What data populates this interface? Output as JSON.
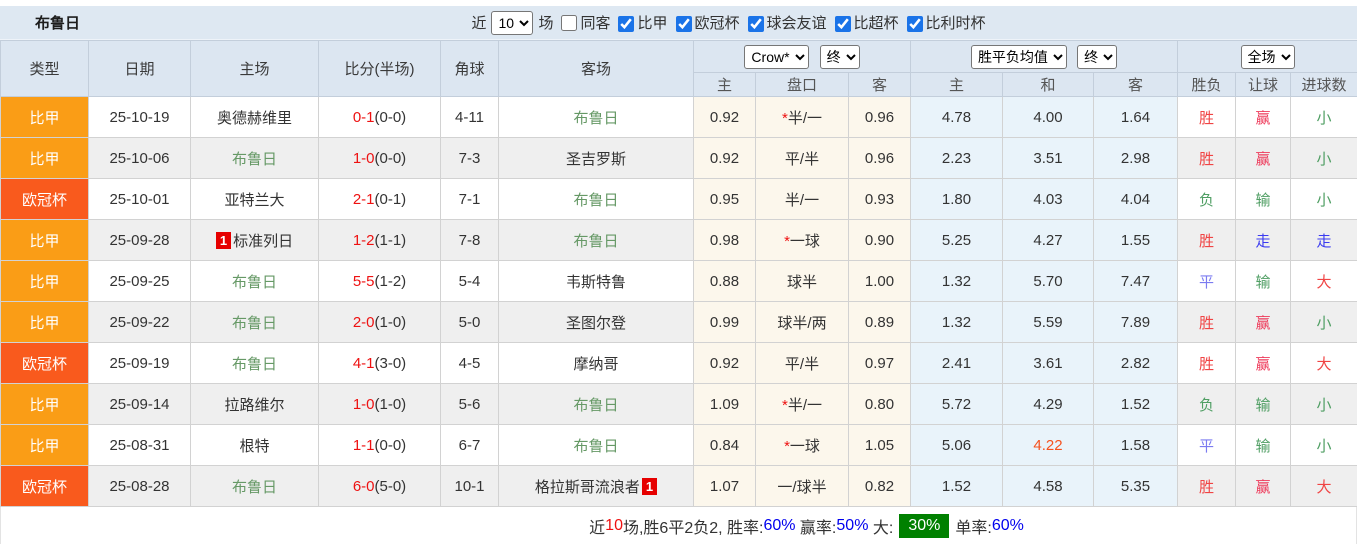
{
  "filter_bar": {
    "title": "布鲁日",
    "recent_label": "近",
    "matches_select": "10",
    "matches_label": "场",
    "same_opponent": {
      "label": "同客",
      "checked": false
    },
    "leagues": [
      {
        "label": "比甲",
        "checked": true
      },
      {
        "label": "欧冠杯",
        "checked": true
      },
      {
        "label": "球会友谊",
        "checked": true
      },
      {
        "label": "比超杯",
        "checked": true
      },
      {
        "label": "比利时杯",
        "checked": true
      }
    ]
  },
  "colors": {
    "league_bijia": "#fa9d16",
    "league_ouguan": "#f95a1d",
    "team_green": "#669966",
    "plain_dark": "#333333",
    "red": "#f04444",
    "crimson": "#ee3b5b",
    "blue": "#7b7bf0",
    "goblue": "#3c3cf0",
    "green": "#4f9e63",
    "odds_highlight": "#f5511e"
  },
  "table": {
    "static_headers": [
      "类型",
      "日期",
      "主场",
      "比分(半场)",
      "角球",
      "客场"
    ],
    "group_selects": {
      "odds_company": "Crow*",
      "odds_time": "终",
      "mean_label": "胜平负均值",
      "mean_time": "终",
      "scope": "全场"
    },
    "sub_headers": [
      "主",
      "盘口",
      "客",
      "主",
      "和",
      "客",
      "胜负",
      "让球",
      "进球数"
    ],
    "rows": [
      {
        "league": {
          "t": "比甲",
          "c": "league_bijia"
        },
        "date": "25-10-19",
        "home": {
          "t": "奥德赫维里",
          "team": false
        },
        "score": "0-1",
        "half": "(0-0)",
        "corners": "4-11",
        "away": {
          "t": "布鲁日",
          "team": true
        },
        "odds_home": "0.92",
        "handicap": {
          "star": true,
          "t": "半/一"
        },
        "odds_away": "0.96",
        "mean": [
          {
            "t": "4.78"
          },
          {
            "t": "4.00"
          },
          {
            "t": "1.64"
          }
        ],
        "results": [
          {
            "t": "胜",
            "c": "red"
          },
          {
            "t": "赢",
            "c": "crimson"
          },
          {
            "t": "小",
            "c": "green"
          }
        ]
      },
      {
        "league": {
          "t": "比甲",
          "c": "league_bijia"
        },
        "date": "25-10-06",
        "home": {
          "t": "布鲁日",
          "team": true
        },
        "score": "1-0",
        "half": "(0-0)",
        "corners": "7-3",
        "away": {
          "t": "圣吉罗斯",
          "team": false
        },
        "odds_home": "0.92",
        "handicap": {
          "star": false,
          "t": "平/半"
        },
        "odds_away": "0.96",
        "mean": [
          {
            "t": "2.23"
          },
          {
            "t": "3.51"
          },
          {
            "t": "2.98"
          }
        ],
        "results": [
          {
            "t": "胜",
            "c": "red"
          },
          {
            "t": "赢",
            "c": "crimson"
          },
          {
            "t": "小",
            "c": "green"
          }
        ]
      },
      {
        "league": {
          "t": "欧冠杯",
          "c": "league_ouguan"
        },
        "date": "25-10-01",
        "home": {
          "t": "亚特兰大",
          "team": false
        },
        "score": "2-1",
        "half": "(0-1)",
        "corners": "7-1",
        "away": {
          "t": "布鲁日",
          "team": true
        },
        "odds_home": "0.95",
        "handicap": {
          "star": false,
          "t": "半/一"
        },
        "odds_away": "0.93",
        "mean": [
          {
            "t": "1.80"
          },
          {
            "t": "4.03"
          },
          {
            "t": "4.04"
          }
        ],
        "results": [
          {
            "t": "负",
            "c": "green"
          },
          {
            "t": "输",
            "c": "green"
          },
          {
            "t": "小",
            "c": "green"
          }
        ]
      },
      {
        "league": {
          "t": "比甲",
          "c": "league_bijia"
        },
        "date": "25-09-28",
        "home": {
          "t": "标准列日",
          "team": false,
          "rc": 1,
          "rc_pos": "pre"
        },
        "score": "1-2",
        "half": "(1-1)",
        "corners": "7-8",
        "away": {
          "t": "布鲁日",
          "team": true
        },
        "odds_home": "0.98",
        "handicap": {
          "star": true,
          "t": "一球"
        },
        "odds_away": "0.90",
        "mean": [
          {
            "t": "5.25"
          },
          {
            "t": "4.27"
          },
          {
            "t": "1.55"
          }
        ],
        "results": [
          {
            "t": "胜",
            "c": "red"
          },
          {
            "t": "走",
            "c": "goblue"
          },
          {
            "t": "走",
            "c": "goblue"
          }
        ]
      },
      {
        "league": {
          "t": "比甲",
          "c": "league_bijia"
        },
        "date": "25-09-25",
        "home": {
          "t": "布鲁日",
          "team": true
        },
        "score": "5-5",
        "half": "(1-2)",
        "corners": "5-4",
        "away": {
          "t": "韦斯特鲁",
          "team": false
        },
        "odds_home": "0.88",
        "handicap": {
          "star": false,
          "t": "球半"
        },
        "odds_away": "1.00",
        "mean": [
          {
            "t": "1.32"
          },
          {
            "t": "5.70"
          },
          {
            "t": "7.47"
          }
        ],
        "results": [
          {
            "t": "平",
            "c": "blue"
          },
          {
            "t": "输",
            "c": "green"
          },
          {
            "t": "大",
            "c": "red"
          }
        ]
      },
      {
        "league": {
          "t": "比甲",
          "c": "league_bijia"
        },
        "date": "25-09-22",
        "home": {
          "t": "布鲁日",
          "team": true
        },
        "score": "2-0",
        "half": "(1-0)",
        "corners": "5-0",
        "away": {
          "t": "圣图尔登",
          "team": false
        },
        "odds_home": "0.99",
        "handicap": {
          "star": false,
          "t": "球半/两"
        },
        "odds_away": "0.89",
        "mean": [
          {
            "t": "1.32"
          },
          {
            "t": "5.59"
          },
          {
            "t": "7.89"
          }
        ],
        "results": [
          {
            "t": "胜",
            "c": "red"
          },
          {
            "t": "赢",
            "c": "crimson"
          },
          {
            "t": "小",
            "c": "green"
          }
        ]
      },
      {
        "league": {
          "t": "欧冠杯",
          "c": "league_ouguan"
        },
        "date": "25-09-19",
        "home": {
          "t": "布鲁日",
          "team": true
        },
        "score": "4-1",
        "half": "(3-0)",
        "corners": "4-5",
        "away": {
          "t": "摩纳哥",
          "team": false
        },
        "odds_home": "0.92",
        "handicap": {
          "star": false,
          "t": "平/半"
        },
        "odds_away": "0.97",
        "mean": [
          {
            "t": "2.41"
          },
          {
            "t": "3.61"
          },
          {
            "t": "2.82"
          }
        ],
        "results": [
          {
            "t": "胜",
            "c": "red"
          },
          {
            "t": "赢",
            "c": "crimson"
          },
          {
            "t": "大",
            "c": "red"
          }
        ]
      },
      {
        "league": {
          "t": "比甲",
          "c": "league_bijia"
        },
        "date": "25-09-14",
        "home": {
          "t": "拉路维尔",
          "team": false
        },
        "score": "1-0",
        "half": "(1-0)",
        "corners": "5-6",
        "away": {
          "t": "布鲁日",
          "team": true
        },
        "odds_home": "1.09",
        "handicap": {
          "star": true,
          "t": "半/一"
        },
        "odds_away": "0.80",
        "mean": [
          {
            "t": "5.72"
          },
          {
            "t": "4.29"
          },
          {
            "t": "1.52"
          }
        ],
        "results": [
          {
            "t": "负",
            "c": "green"
          },
          {
            "t": "输",
            "c": "green"
          },
          {
            "t": "小",
            "c": "green"
          }
        ]
      },
      {
        "league": {
          "t": "比甲",
          "c": "league_bijia"
        },
        "date": "25-08-31",
        "home": {
          "t": "根特",
          "team": false
        },
        "score": "1-1",
        "half": "(0-0)",
        "corners": "6-7",
        "away": {
          "t": "布鲁日",
          "team": true
        },
        "odds_home": "0.84",
        "handicap": {
          "star": true,
          "t": "一球"
        },
        "odds_away": "1.05",
        "mean": [
          {
            "t": "5.06"
          },
          {
            "t": "4.22",
            "c": "odds_highlight"
          },
          {
            "t": "1.58"
          }
        ],
        "results": [
          {
            "t": "平",
            "c": "blue"
          },
          {
            "t": "输",
            "c": "green"
          },
          {
            "t": "小",
            "c": "green"
          }
        ]
      },
      {
        "league": {
          "t": "欧冠杯",
          "c": "league_ouguan"
        },
        "date": "25-08-28",
        "home": {
          "t": "布鲁日",
          "team": true
        },
        "score": "6-0",
        "half": "(5-0)",
        "corners": "10-1",
        "away": {
          "t": "格拉斯哥流浪者",
          "team": false,
          "rc": 1,
          "rc_pos": "post"
        },
        "odds_home": "1.07",
        "handicap": {
          "star": false,
          "t": "一/球半"
        },
        "odds_away": "0.82",
        "mean": [
          {
            "t": "1.52"
          },
          {
            "t": "4.58"
          },
          {
            "t": "5.35"
          }
        ],
        "results": [
          {
            "t": "胜",
            "c": "red"
          },
          {
            "t": "赢",
            "c": "crimson"
          },
          {
            "t": "大",
            "c": "red"
          }
        ]
      }
    ]
  },
  "summary": {
    "segments": [
      {
        "t": "近",
        "s": "plain"
      },
      {
        "t": "10",
        "s": "red"
      },
      {
        "t": "场,胜6平2负2, 胜率:",
        "s": "plain"
      },
      {
        "t": "60%",
        "s": "blue"
      },
      {
        "t": " 赢率:",
        "s": "plain"
      },
      {
        "t": "50%",
        "s": "blue"
      },
      {
        "t": " 大:",
        "s": "plain"
      },
      {
        "t": "30%",
        "s": "greenbox"
      },
      {
        "t": "单率:",
        "s": "plain"
      },
      {
        "t": "60%",
        "s": "blue"
      }
    ]
  }
}
